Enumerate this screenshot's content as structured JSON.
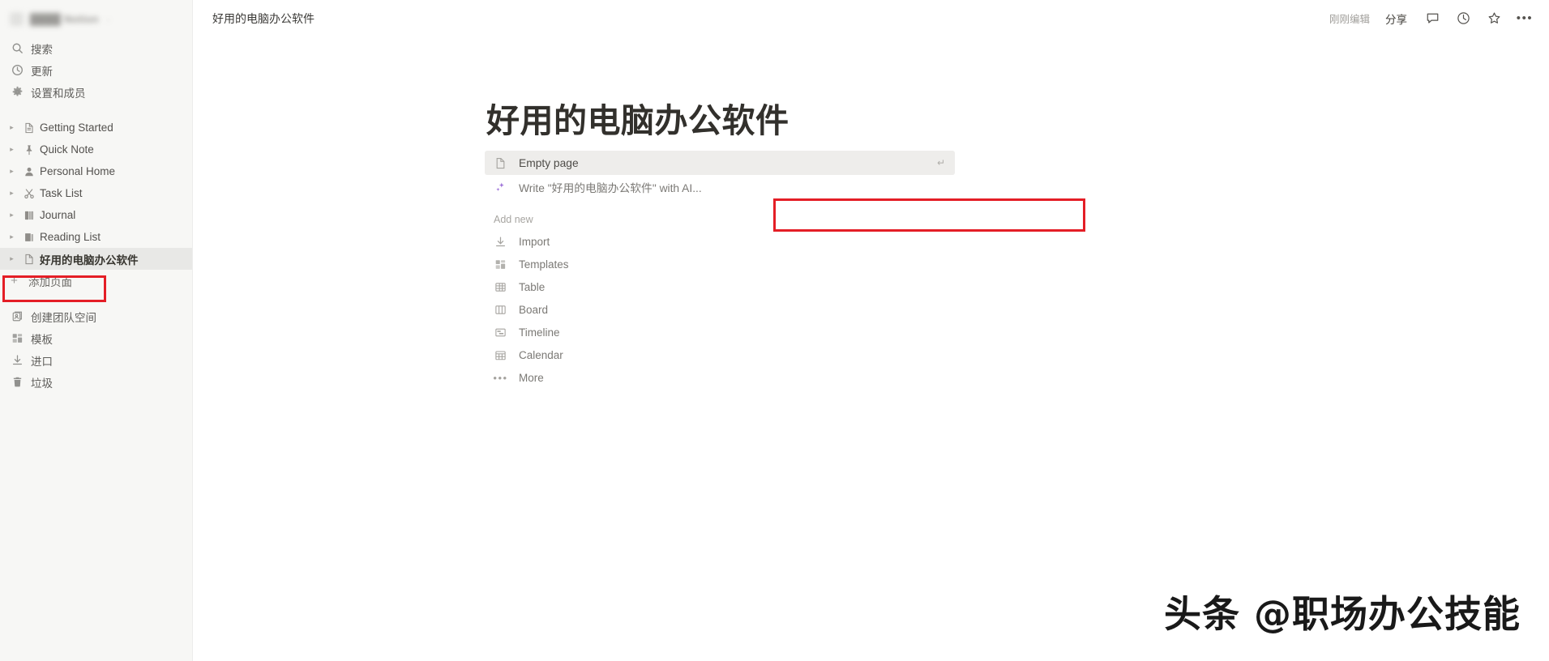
{
  "sidebar": {
    "workspace": {
      "name": "████ Notion",
      "caret": "⌄"
    },
    "nav": [
      {
        "label": "搜索",
        "icon": "search-icon",
        "name": "sidebar-item-search"
      },
      {
        "label": "更新",
        "icon": "clock-icon",
        "name": "sidebar-item-updates"
      },
      {
        "label": "设置和成员",
        "icon": "gear-icon",
        "name": "sidebar-item-settings-members"
      }
    ],
    "pages": [
      {
        "label": "Getting Started",
        "icon": "document-icon",
        "selected": false
      },
      {
        "label": "Quick Note",
        "icon": "pin-icon",
        "selected": false
      },
      {
        "label": "Personal Home",
        "icon": "person-icon",
        "selected": false
      },
      {
        "label": "Task List",
        "icon": "scissors-icon",
        "selected": false
      },
      {
        "label": "Journal",
        "icon": "book-icon",
        "selected": false
      },
      {
        "label": "Reading List",
        "icon": "books-icon",
        "selected": false
      },
      {
        "label": "好用的电脑办公软件",
        "icon": "document-icon",
        "selected": true
      }
    ],
    "add_page": {
      "label": "添加页面",
      "plus": "+"
    },
    "bottom": [
      {
        "label": "创建团队空间",
        "icon": "teamspace-icon",
        "name": "sidebar-item-create-teamspace"
      },
      {
        "label": "模板",
        "icon": "templates-icon",
        "name": "sidebar-item-templates"
      },
      {
        "label": "进口",
        "icon": "import-icon",
        "name": "sidebar-item-import"
      },
      {
        "label": "垃圾",
        "icon": "trash-icon",
        "name": "sidebar-item-trash"
      }
    ]
  },
  "topbar": {
    "breadcrumb": "好用的电脑办公软件",
    "edited_status": "刚刚编辑",
    "share_label": "分享",
    "icons": [
      {
        "name": "comment-icon"
      },
      {
        "name": "clock-history-icon"
      },
      {
        "name": "star-icon"
      },
      {
        "name": "more-options-icon",
        "glyph": "•••"
      }
    ]
  },
  "main": {
    "page_title": "好用的电脑办公软件",
    "suggestions": [
      {
        "label": "Empty page",
        "icon": "document-icon",
        "enter_hint": "↵",
        "hovered": true
      },
      {
        "label": "Write \"好用的电脑办公软件\" with AI...",
        "icon": "sparkle-ai-icon",
        "highlighted": true
      }
    ],
    "add_new_heading": "Add new",
    "add_new_items": [
      {
        "label": "Import",
        "icon": "import-icon"
      },
      {
        "label": "Templates",
        "icon": "templates-icon"
      },
      {
        "label": "Table",
        "icon": "table-icon"
      },
      {
        "label": "Board",
        "icon": "board-icon"
      },
      {
        "label": "Timeline",
        "icon": "timeline-icon"
      },
      {
        "label": "Calendar",
        "icon": "calendar-icon"
      },
      {
        "label": "More",
        "icon": "more-dots-icon"
      }
    ]
  },
  "watermark": {
    "text": "头条 @职场办公技能"
  },
  "colors": {
    "annotation_red": "#e41e26",
    "sidebar_bg": "#f7f7f5",
    "selected_row": "#e8e8e6",
    "ai_purple": "#9a6dd7"
  }
}
